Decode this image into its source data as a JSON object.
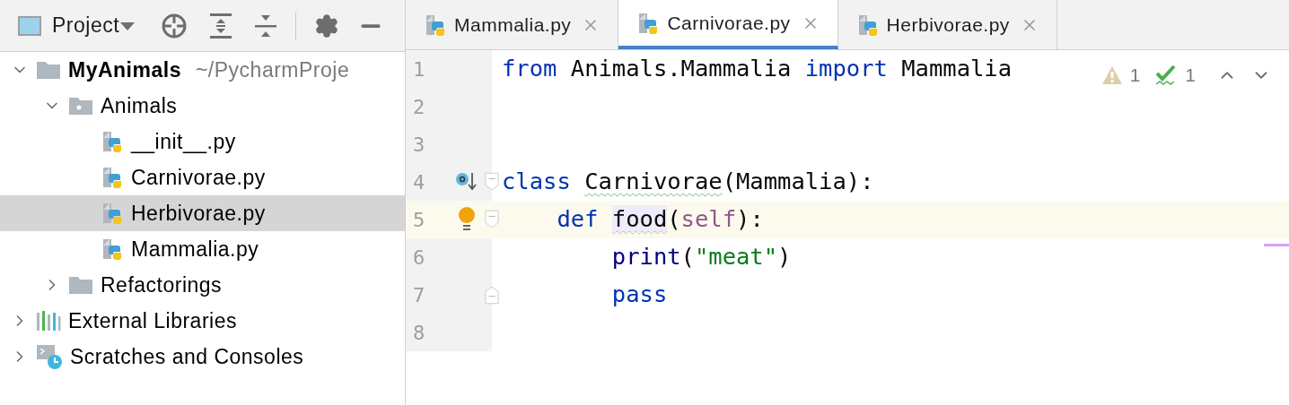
{
  "project_panel": {
    "title": "Project",
    "tree": [
      {
        "kind": "project",
        "label": "MyAnimals",
        "hint": "~/PycharmProje",
        "expanded": true,
        "selected": false,
        "children": [
          {
            "kind": "package",
            "label": "Animals",
            "expanded": true,
            "selected": false,
            "children": [
              {
                "kind": "python",
                "label": "__init__.py",
                "selected": false
              },
              {
                "kind": "python",
                "label": "Carnivorae.py",
                "selected": false
              },
              {
                "kind": "python",
                "label": "Herbivorae.py",
                "selected": true
              },
              {
                "kind": "python",
                "label": "Mammalia.py",
                "selected": false
              }
            ]
          },
          {
            "kind": "folder",
            "label": "Refactorings",
            "expanded": false,
            "selected": false
          }
        ]
      },
      {
        "kind": "libraries",
        "label": "External Libraries",
        "expanded": false,
        "selected": false
      },
      {
        "kind": "scratches",
        "label": "Scratches and Consoles",
        "expanded": false,
        "selected": false
      }
    ]
  },
  "tabs": [
    {
      "label": "Mammalia.py",
      "selected": false
    },
    {
      "label": "Carnivorae.py",
      "selected": true
    },
    {
      "label": "Herbivorae.py",
      "selected": false
    }
  ],
  "inspections": {
    "warnings": "1",
    "typos": "1"
  },
  "code_lines": [
    {
      "number": "1",
      "current": false,
      "implements": false,
      "intention": false,
      "fold_start": false,
      "fold_end": false,
      "tokens": [
        {
          "kind": "keyword",
          "text": "from"
        },
        {
          "kind": "plain",
          "text": " Animals.Mammalia "
        },
        {
          "kind": "keyword",
          "text": "import"
        },
        {
          "kind": "plain",
          "text": " Mammalia"
        }
      ]
    },
    {
      "number": "2",
      "current": false,
      "implements": false,
      "intention": false,
      "fold_start": false,
      "fold_end": false
    },
    {
      "number": "3",
      "current": false,
      "implements": false,
      "intention": false,
      "fold_start": false,
      "fold_end": false
    },
    {
      "number": "4",
      "current": false,
      "implements": true,
      "intention": false,
      "fold_start": true,
      "fold_end": false,
      "tokens": [
        {
          "kind": "keyword",
          "text": "class "
        },
        {
          "kind": "typo",
          "text": "Carnivorae"
        },
        {
          "kind": "plain",
          "text": "(Mammalia):"
        }
      ]
    },
    {
      "number": "5",
      "current": true,
      "implements": false,
      "intention": true,
      "fold_start": true,
      "fold_end": false,
      "tokens": [
        {
          "kind": "keyword",
          "text": "    def "
        },
        {
          "kind": "warning",
          "text": "food"
        },
        {
          "kind": "plain",
          "text": "("
        },
        {
          "kind": "self",
          "text": "self"
        },
        {
          "kind": "plain",
          "text": "):"
        }
      ]
    },
    {
      "number": "6",
      "current": false,
      "implements": false,
      "intention": false,
      "fold_start": false,
      "fold_end": false,
      "tokens": [
        {
          "kind": "builtin",
          "text": "        print"
        },
        {
          "kind": "plain",
          "text": "("
        },
        {
          "kind": "string",
          "text": "\"meat\""
        },
        {
          "kind": "plain",
          "text": ")"
        }
      ]
    },
    {
      "number": "7",
      "current": false,
      "implements": false,
      "intention": false,
      "fold_start": false,
      "fold_end": true,
      "tokens": [
        {
          "kind": "keyword",
          "text": "        pass"
        }
      ]
    },
    {
      "number": "8",
      "current": false,
      "implements": false,
      "intention": false,
      "fold_start": false,
      "fold_end": false
    }
  ]
}
